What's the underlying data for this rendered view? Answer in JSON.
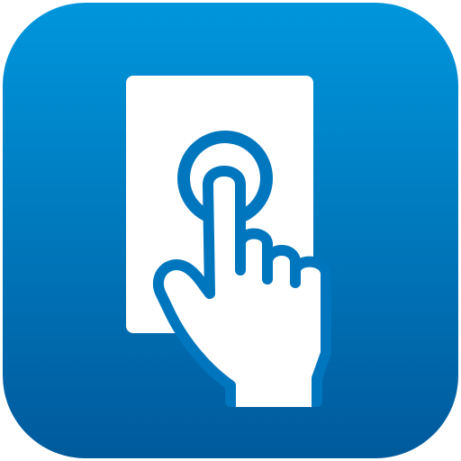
{
  "icon": {
    "name": "touch-tap-icon",
    "background_gradient": [
      "#0096DC",
      "#005A9C"
    ],
    "foreground_color": "#FFFFFF",
    "stroke_color": "#0076BE"
  }
}
